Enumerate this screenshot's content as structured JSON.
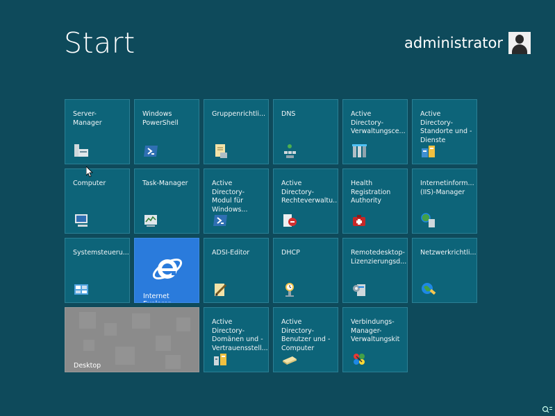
{
  "header": {
    "title": "Start",
    "user_name": "administrator"
  },
  "tiles": [
    {
      "label": "Server-Manager",
      "icon": "server-manager-icon"
    },
    {
      "label": "Windows PowerShell",
      "icon": "powershell-icon"
    },
    {
      "label": "Gruppenrichtli...",
      "icon": "group-policy-icon"
    },
    {
      "label": "DNS",
      "icon": "dns-icon"
    },
    {
      "label": "Active Directory-Verwaltungsce...",
      "icon": "ad-admin-center-icon"
    },
    {
      "label": "Active Directory-Standorte und -Dienste",
      "icon": "ad-sites-icon"
    },
    {
      "label": "Computer",
      "icon": "computer-icon"
    },
    {
      "label": "Task-Manager",
      "icon": "task-manager-icon"
    },
    {
      "label": "Active Directory-Modul für Windows...",
      "icon": "powershell-icon"
    },
    {
      "label": "Active Directory-Rechteverwaltu...",
      "icon": "rights-management-icon"
    },
    {
      "label": "Health Registration Authority",
      "icon": "health-authority-icon"
    },
    {
      "label": "Internetinform... (IIS)-Manager",
      "icon": "iis-manager-icon"
    },
    {
      "label": "Systemsteueru...",
      "icon": "control-panel-icon"
    },
    {
      "label": "Internet Explorer",
      "icon": "internet-explorer-icon"
    },
    {
      "label": "ADSI-Editor",
      "icon": "adsi-editor-icon"
    },
    {
      "label": "DHCP",
      "icon": "dhcp-icon"
    },
    {
      "label": "Remotedesktop-Lizenzierungsd...",
      "icon": "rd-licensing-icon"
    },
    {
      "label": "Netzwerkrichtli...",
      "icon": "network-policy-icon"
    },
    {
      "label": "Desktop",
      "icon": "desktop-icon"
    },
    {
      "label": "Active Directory-Domänen und -Vertrauensstell...",
      "icon": "ad-domains-icon"
    },
    {
      "label": "Active Directory-Benutzer und -Computer",
      "icon": "ad-users-icon"
    },
    {
      "label": "Verbindungs-Manager-Verwaltungskit",
      "icon": "connection-manager-icon"
    }
  ],
  "status": {
    "corner_icon": "zoom-icon"
  }
}
